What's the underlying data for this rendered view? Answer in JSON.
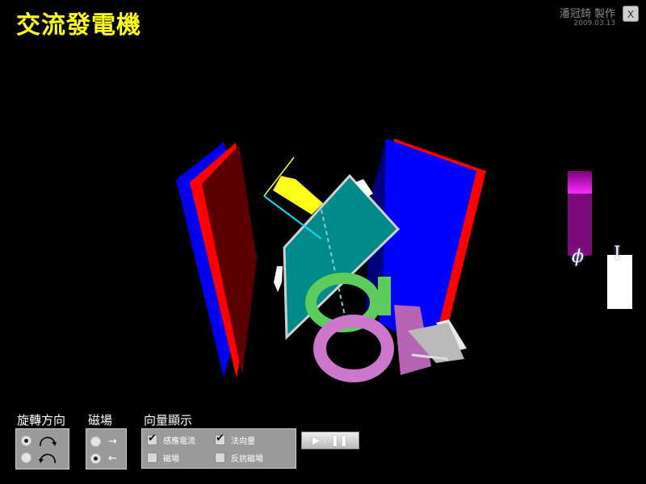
{
  "header": {
    "title": "交流發電機",
    "author": "潘冠錡 製作",
    "date": "2009.03.13",
    "close_label": "X"
  },
  "meters": {
    "flux_symbol": "ϕ",
    "current_symbol": "I",
    "flux_color": "#7a0b7a",
    "current_color": "#ffffff"
  },
  "controls": {
    "rotation": {
      "label": "旋轉方向",
      "options": [
        {
          "icon": "clockwise-arrow-icon",
          "selected": true
        },
        {
          "icon": "counterclockwise-arrow-icon",
          "selected": false
        }
      ]
    },
    "magnet": {
      "label": "磁場",
      "options": [
        {
          "glyph": "→",
          "selected": false
        },
        {
          "glyph": "←",
          "selected": true
        }
      ]
    },
    "vectors": {
      "label": "向量顯示",
      "items": [
        {
          "label": "感應電流",
          "checked": true
        },
        {
          "label": "法向量",
          "checked": true
        },
        {
          "label": "磁場",
          "checked": false
        },
        {
          "label": "反抗磁場",
          "checked": false
        }
      ]
    },
    "play_pause": {
      "label": "▶ / ❚❚"
    }
  },
  "colors": {
    "title": "#ffff1a",
    "magnet_red": "#ff0000",
    "magnet_blue": "#0000ff",
    "coil_plane": "#008a8a",
    "slip_ring_green": "#5ccc5c",
    "slip_ring_purple": "#cc77cc"
  }
}
